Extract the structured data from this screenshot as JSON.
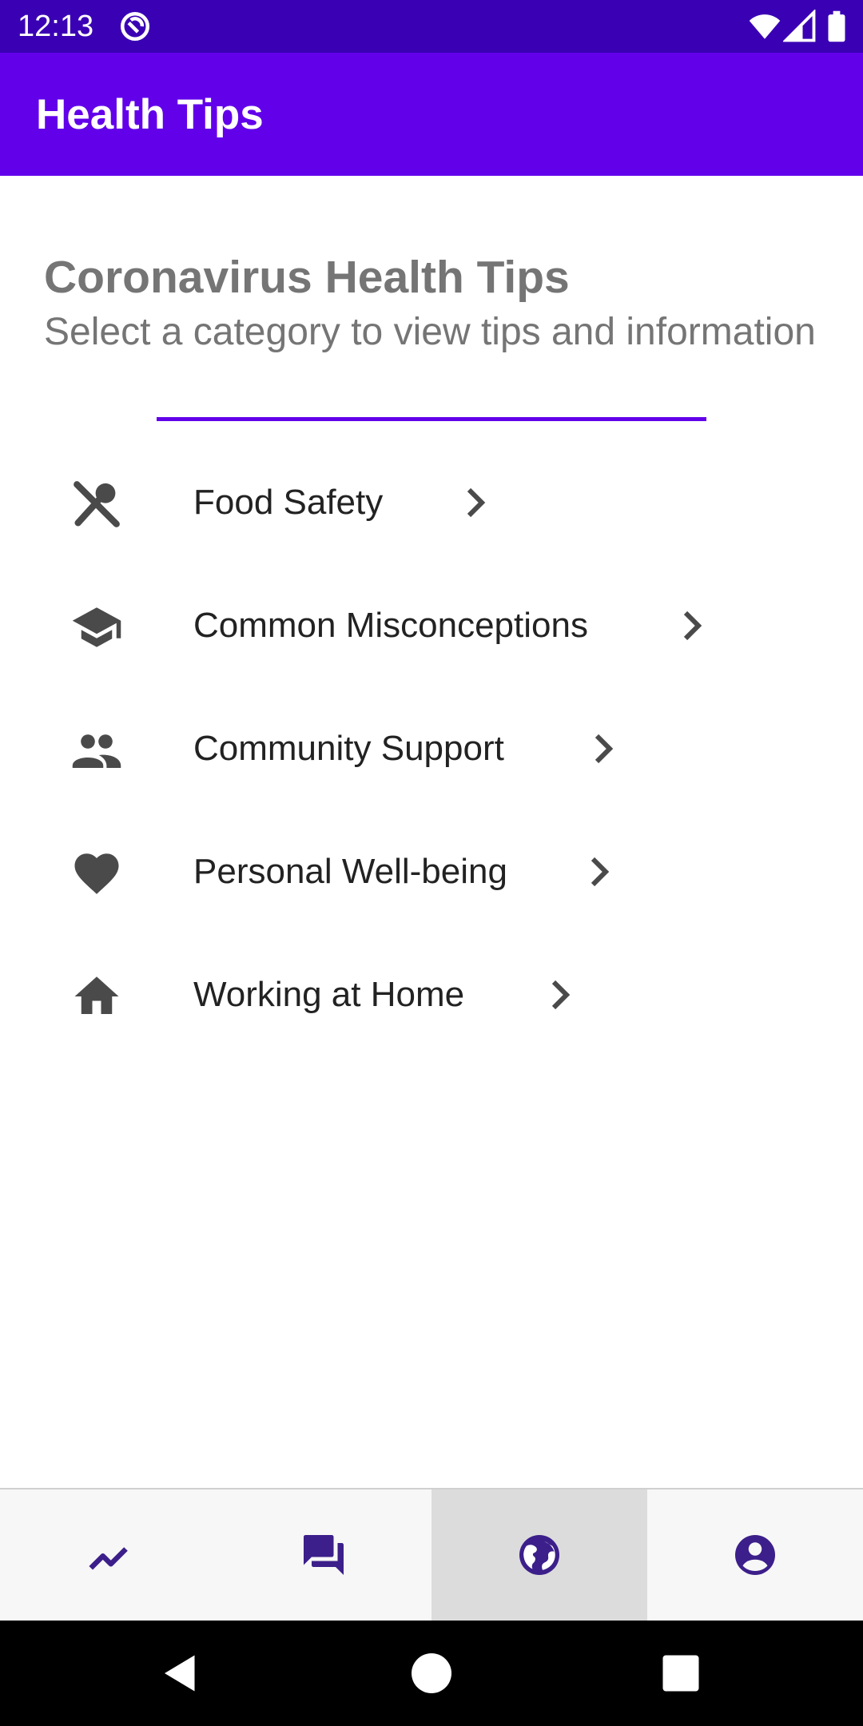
{
  "status_bar": {
    "time": "12:13",
    "icons": [
      "sync-icon",
      "wifi-icon",
      "cell-signal-icon",
      "battery-icon"
    ]
  },
  "app_bar": {
    "title": "Health Tips",
    "color": "#6200ea"
  },
  "content": {
    "title": "Coronavirus Health Tips",
    "subtitle": "Select a category to view tips and information"
  },
  "categories": [
    {
      "label": "Food Safety",
      "icon": "utensils-icon"
    },
    {
      "label": "Common Misconceptions",
      "icon": "school-icon"
    },
    {
      "label": "Community Support",
      "icon": "people-icon"
    },
    {
      "label": "Personal Well-being",
      "icon": "heart-icon"
    },
    {
      "label": "Working at Home",
      "icon": "home-icon"
    }
  ],
  "bottom_nav": {
    "items": [
      {
        "name": "trends",
        "icon": "trending-icon"
      },
      {
        "name": "forum",
        "icon": "chat-icon"
      },
      {
        "name": "globe",
        "icon": "globe-icon",
        "selected": true
      },
      {
        "name": "profile",
        "icon": "account-icon"
      }
    ],
    "accent": "#3c1f8a"
  },
  "system_nav": {
    "icons": [
      "back-icon",
      "home-circle-icon",
      "recents-icon"
    ]
  }
}
